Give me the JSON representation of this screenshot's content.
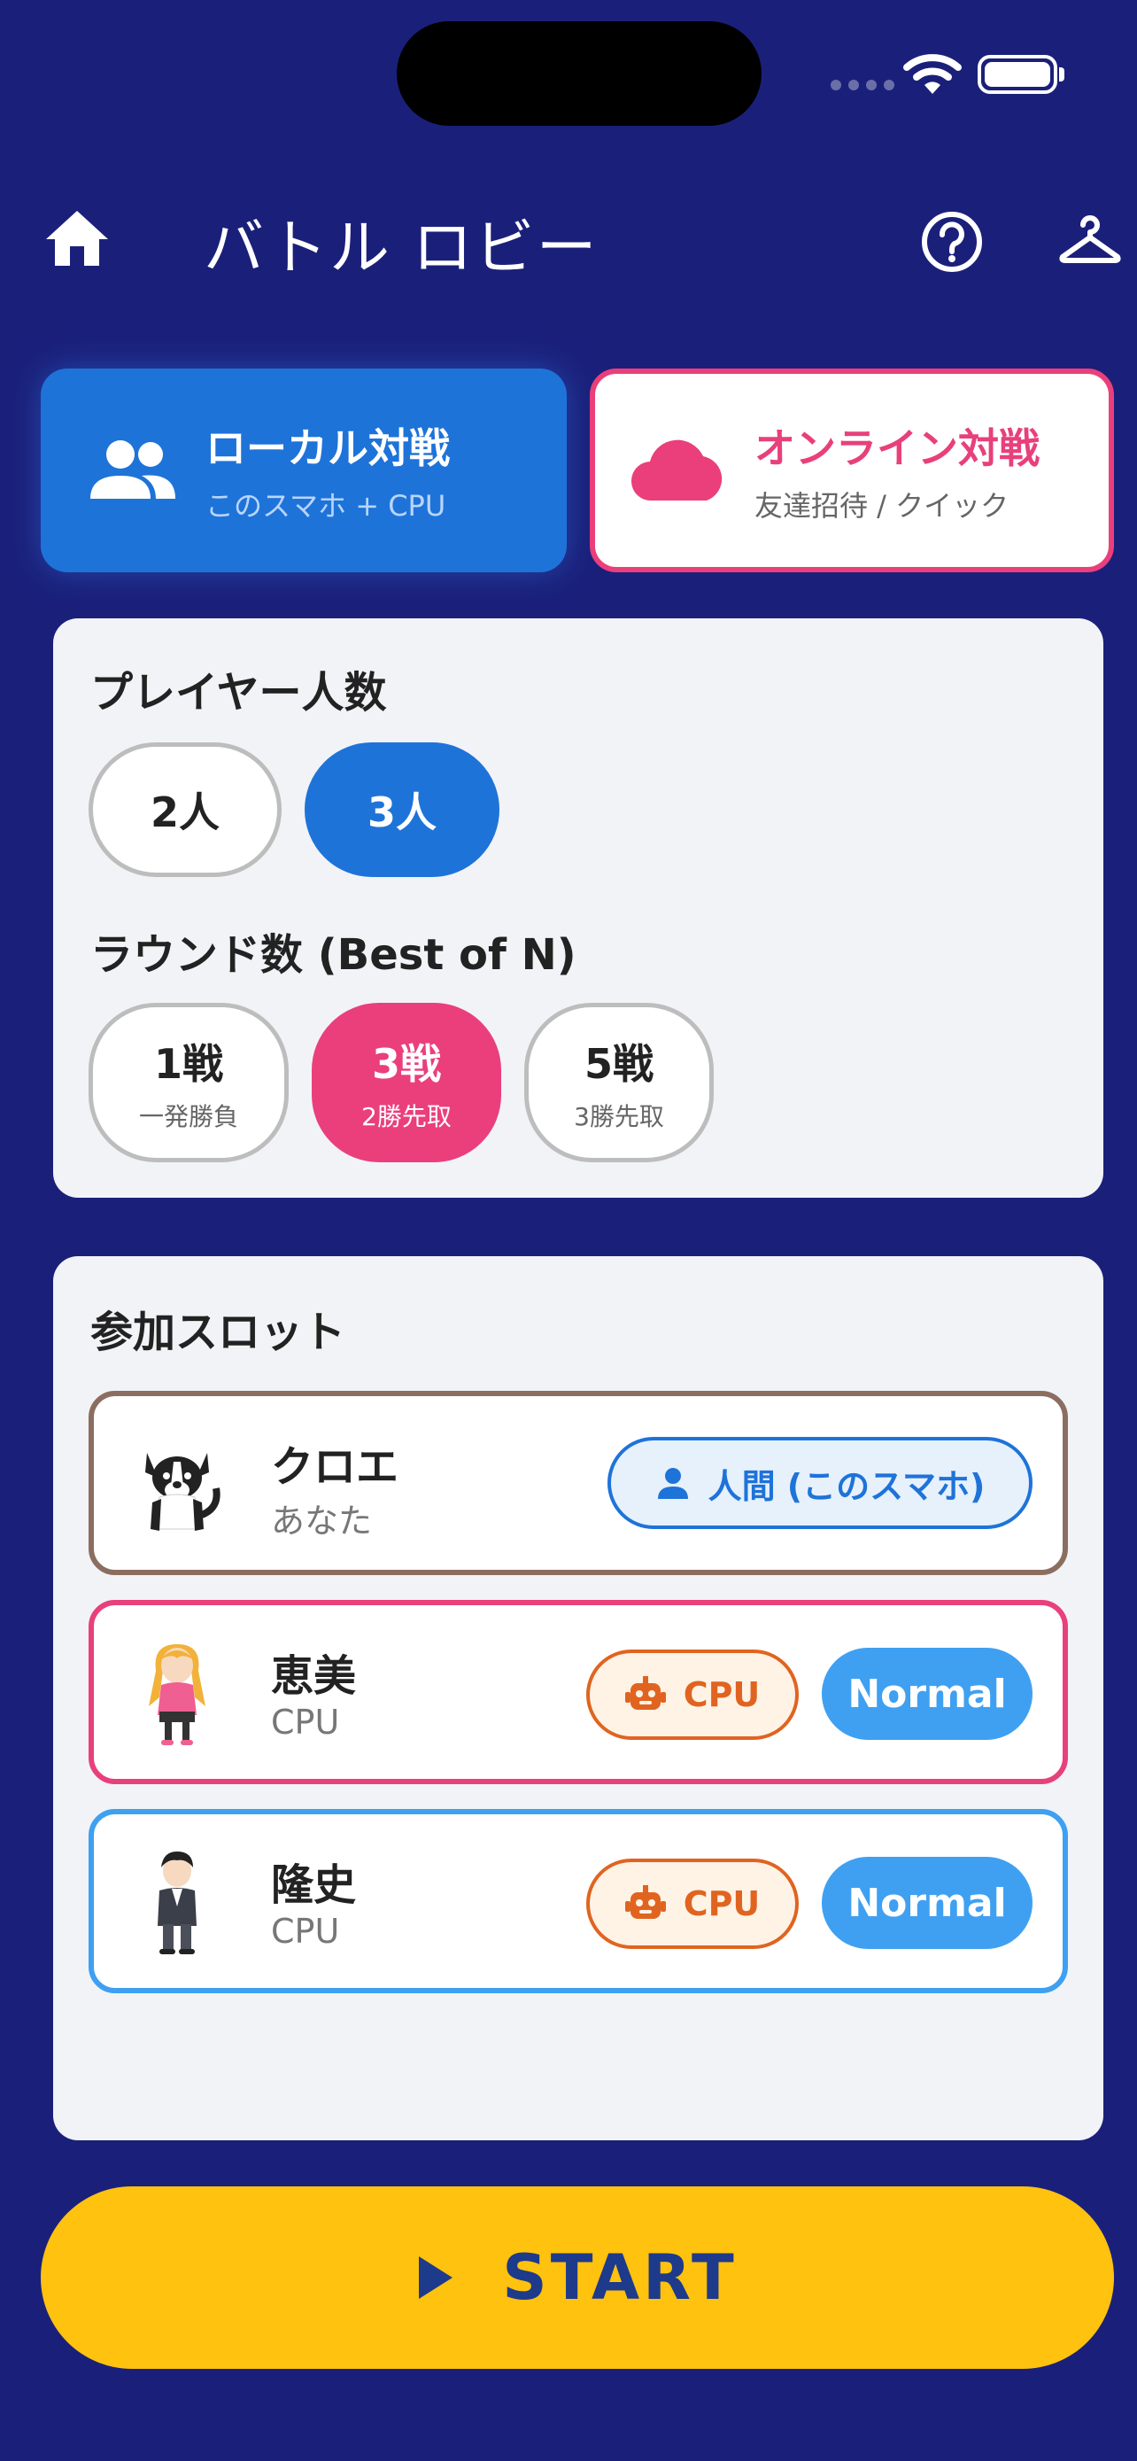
{
  "header": {
    "title": "バトル ロビー",
    "icons": [
      "home-icon",
      "help-icon",
      "hanger-icon"
    ]
  },
  "mode_tabs": {
    "local": {
      "title": "ローカル対戦",
      "subtitle": "このスマホ + CPU",
      "icon": "group-icon",
      "selected": true
    },
    "online": {
      "title": "オンライン対戦",
      "subtitle": "友達招待 / クイック",
      "icon": "cloud-icon",
      "selected": false
    }
  },
  "settings": {
    "players_label": "プレイヤー人数",
    "players_options": [
      {
        "label": "2人",
        "selected": false
      },
      {
        "label": "3人",
        "selected": true
      }
    ],
    "rounds_label": "ラウンド数 (Best of N)",
    "rounds_options": [
      {
        "label": "1戦",
        "sub": "一発勝負",
        "selected": false
      },
      {
        "label": "3戦",
        "sub": "2勝先取",
        "selected": true
      },
      {
        "label": "5戦",
        "sub": "3勝先取",
        "selected": false
      }
    ]
  },
  "slots": {
    "label": "参加スロット",
    "items": [
      {
        "name": "クロエ",
        "role": "あなた",
        "type_label": "人間 (このスマホ)",
        "type": "human",
        "border_color": "#8c6e60"
      },
      {
        "name": "恵美",
        "role": "CPU",
        "type_label": "CPU",
        "type": "cpu",
        "level": "Normal",
        "border_color": "#e8407b"
      },
      {
        "name": "隆史",
        "role": "CPU",
        "type_label": "CPU",
        "type": "cpu",
        "level": "Normal",
        "border_color": "#3fa0f2"
      }
    ]
  },
  "start": {
    "label": "START"
  },
  "colors": {
    "background": "#1a207a",
    "primary_blue": "#1e73d9",
    "accent_pink": "#ea3f7b",
    "start_yellow": "#ffc20f",
    "cpu_orange": "#e06420"
  }
}
